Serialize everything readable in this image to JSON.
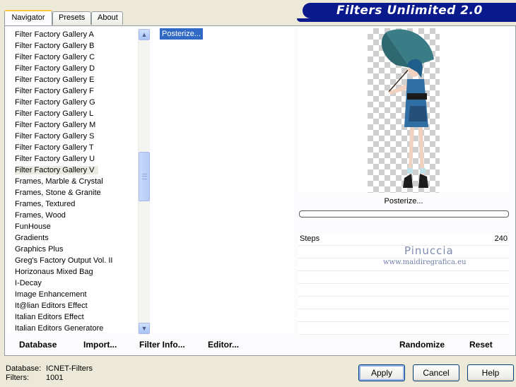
{
  "tabs": [
    {
      "label": "Navigator",
      "active": true
    },
    {
      "label": "Presets",
      "active": false
    },
    {
      "label": "About",
      "active": false
    }
  ],
  "title": "Filters Unlimited 2.0",
  "categories": {
    "items": [
      "Filter Factory Gallery A",
      "Filter Factory Gallery B",
      "Filter Factory Gallery C",
      "Filter Factory Gallery D",
      "Filter Factory Gallery E",
      "Filter Factory Gallery F",
      "Filter Factory Gallery G",
      "Filter Factory Gallery L",
      "Filter Factory Gallery M",
      "Filter Factory Gallery S",
      "Filter Factory Gallery T",
      "Filter Factory Gallery U",
      "Filter Factory Gallery V",
      "Frames, Marble & Crystal",
      "Frames, Stone & Granite",
      "Frames, Textured",
      "Frames, Wood",
      "FunHouse",
      "Gradients",
      "Graphics Plus",
      "Greg's Factory Output Vol. II",
      "Horizonaus Mixed Bag",
      "I-Decay",
      "Image Enhancement",
      "It@lian Editors Effect",
      "Italian Editors Effect",
      "Italian Editors Generatore"
    ],
    "selected_index": 12
  },
  "filters": {
    "selected": "Posterize..."
  },
  "preview": {
    "filter_name": "Posterize..."
  },
  "params": [
    {
      "label": "Steps",
      "value": "240"
    }
  ],
  "watermark": {
    "name": "Pinuccia",
    "url": "www.maidiregrafica.eu"
  },
  "toolbar": {
    "database": "Database",
    "import": "Import...",
    "filter_info": "Filter Info...",
    "editor": "Editor...",
    "randomize": "Randomize",
    "reset": "Reset"
  },
  "status": {
    "database_label": "Database:",
    "database_value": "ICNET-Filters",
    "filters_label": "Filters:",
    "filters_value": "1001"
  },
  "buttons": {
    "apply": "Apply",
    "cancel": "Cancel",
    "help": "Help"
  },
  "colors": {
    "accent": "#316ac5",
    "banner": "#0a1a8c",
    "tab_highlight": "#ffc83c"
  }
}
